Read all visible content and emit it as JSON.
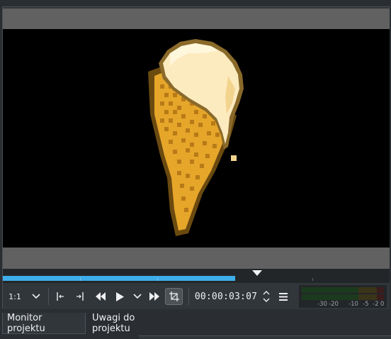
{
  "monitor": {
    "zoom_label": "1:1",
    "timecode": "00:00:03:07",
    "progress_fraction": 0.6
  },
  "tabs": [
    {
      "label": "Monitor projektu",
      "active": true
    },
    {
      "label": "Uwagi do projektu",
      "active": false
    }
  ],
  "audio_meter": {
    "scale_labels": [
      "-30",
      "-20",
      "-10",
      "-5",
      "-2",
      "0"
    ]
  },
  "icons": {
    "zoom_dropdown": "chevron-down-icon",
    "zone_in": "set-zone-in-icon",
    "zone_out": "set-zone-out-icon",
    "rewind": "rewind-icon",
    "play": "play-icon",
    "play_options": "chevron-down-icon",
    "forward": "fast-forward-icon",
    "crop": "crop-icon",
    "timecode_spin": "spin-up-down-icon",
    "menu": "hamburger-menu-icon"
  },
  "colors": {
    "accent": "#3daee9",
    "background": "#31363b",
    "video_bg": "#000000",
    "letterbox": "#616161"
  }
}
